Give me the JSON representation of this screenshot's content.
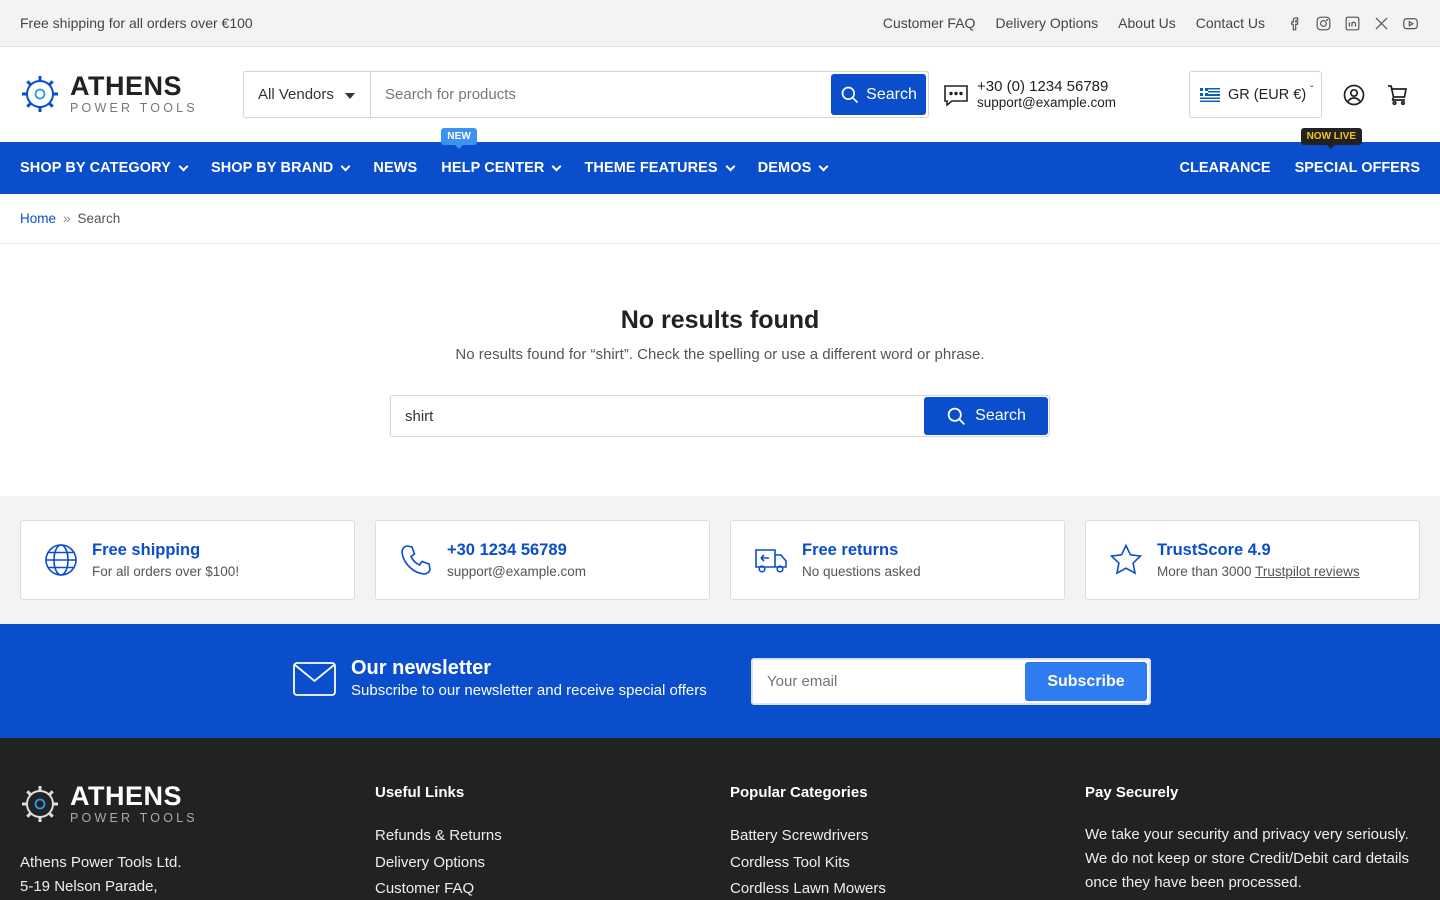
{
  "topbar": {
    "promo": "Free shipping for all orders over €100",
    "links": [
      "Customer FAQ",
      "Delivery Options",
      "About Us",
      "Contact Us"
    ],
    "socials": [
      "facebook-icon",
      "instagram-icon",
      "linkedin-icon",
      "x-icon",
      "youtube-icon"
    ]
  },
  "logo": {
    "line1": "ATHENS",
    "line2": "POWER TOOLS"
  },
  "search": {
    "vendor_label": "All Vendors",
    "placeholder": "Search for products",
    "button_label": "Search"
  },
  "contact": {
    "phone": "+30 (0) 1234 56789",
    "email": "support@example.com"
  },
  "currency": {
    "label": "GR (EUR €)"
  },
  "nav": {
    "items": [
      {
        "label": "SHOP BY CATEGORY",
        "dropdown": true
      },
      {
        "label": "SHOP BY BRAND",
        "dropdown": true
      },
      {
        "label": "NEWS",
        "dropdown": false
      },
      {
        "label": "HELP CENTER",
        "dropdown": true,
        "badge": "NEW"
      },
      {
        "label": "THEME FEATURES",
        "dropdown": true
      },
      {
        "label": "DEMOS",
        "dropdown": true
      }
    ],
    "right": [
      {
        "label": "CLEARANCE"
      },
      {
        "label": "SPECIAL OFFERS",
        "badge": "NOW LIVE"
      }
    ]
  },
  "breadcrumb": {
    "home": "Home",
    "separator": "»",
    "current": "Search"
  },
  "results": {
    "title": "No results found",
    "message": "No results found for “shirt”. Check the spelling or use a different word or phrase.",
    "query": "shirt",
    "button_label": "Search"
  },
  "features": [
    {
      "icon": "globe-icon",
      "title": "Free shipping",
      "desc": "For all orders over $100!"
    },
    {
      "icon": "phone-icon",
      "title": "+30 1234 56789",
      "desc": "support@example.com"
    },
    {
      "icon": "truck-return-icon",
      "title": "Free returns",
      "desc": "No questions asked"
    },
    {
      "icon": "star-icon",
      "title": "TrustScore 4.9",
      "desc_prefix": "More than 3000 ",
      "desc_link": "Trustpilot reviews"
    }
  ],
  "newsletter": {
    "title": "Our newsletter",
    "subtitle": "Subscribe to our newsletter and receive special offers",
    "placeholder": "Your email",
    "button_label": "Subscribe"
  },
  "footer": {
    "address": [
      "Athens Power Tools Ltd.",
      "5-19 Nelson Parade,"
    ],
    "useful_links": {
      "heading": "Useful Links",
      "items": [
        "Refunds & Returns",
        "Delivery Options",
        "Customer FAQ"
      ]
    },
    "popular_categories": {
      "heading": "Popular Categories",
      "items": [
        "Battery Screwdrivers",
        "Cordless Tool Kits",
        "Cordless Lawn Mowers"
      ]
    },
    "pay_securely": {
      "heading": "Pay Securely",
      "lines": [
        "We take your security and privacy very seriously.",
        "We do not keep or store Credit/Debit card details",
        "once they have been processed."
      ]
    }
  },
  "colors": {
    "brand": "#0a4ecb",
    "badge_new": "#3b93ee",
    "badge_live_text": "#f5c518",
    "footer_bg": "#222222",
    "subscribe": "#2f7cf0"
  }
}
